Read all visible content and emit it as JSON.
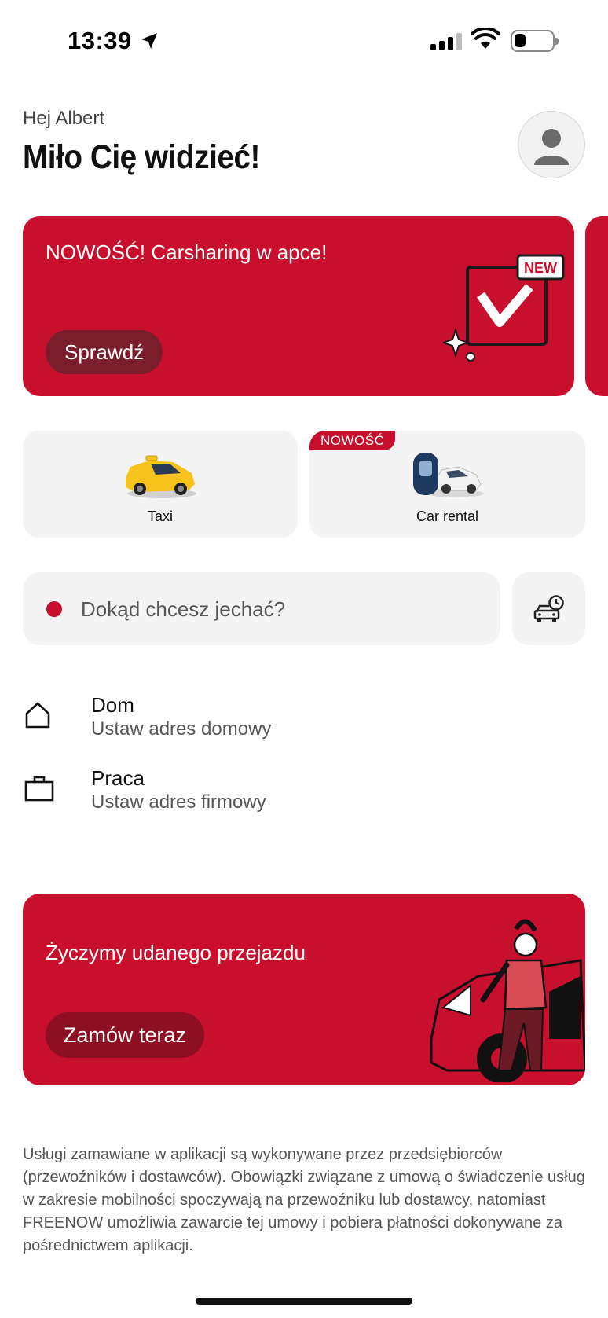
{
  "status_bar": {
    "time": "13:39",
    "battery_level": 0.3
  },
  "header": {
    "greeting": "Hej Albert",
    "title": "Miło Cię widzieć!"
  },
  "promo_banner": {
    "text": "NOWOŚĆ! Carsharing w apce!",
    "button_label": "Sprawdź",
    "new_tag": "NEW"
  },
  "services": [
    {
      "label": "Taxi",
      "badge": ""
    },
    {
      "label": "Car rental",
      "badge": "NOWOŚĆ"
    }
  ],
  "search": {
    "placeholder": "Dokąd chcesz jechać?"
  },
  "saved_places": [
    {
      "title": "Dom",
      "subtitle": "Ustaw adres domowy",
      "icon": "home-icon"
    },
    {
      "title": "Praca",
      "subtitle": "Ustaw adres firmowy",
      "icon": "briefcase-icon"
    }
  ],
  "ride_banner": {
    "text": "Życzymy udanego przejazdu",
    "button_label": "Zamów teraz"
  },
  "disclaimer": "Usługi zamawiane w aplikacji są wykonywane przez przedsiębiorców (przewoźników i dostawców). Obowiązki związane z umową o świadczenie usług w zakresie mobilności spoczywają na przewoźniku lub dostawcy, natomiast FREENOW umożliwia zawarcie tej umowy i pobiera płatności dokonywane za pośrednictwem aplikacji.",
  "colors": {
    "brand_red": "#c8102e",
    "button_dark_red": "#7a1e2c",
    "tile_bg": "#f4f4f4"
  }
}
